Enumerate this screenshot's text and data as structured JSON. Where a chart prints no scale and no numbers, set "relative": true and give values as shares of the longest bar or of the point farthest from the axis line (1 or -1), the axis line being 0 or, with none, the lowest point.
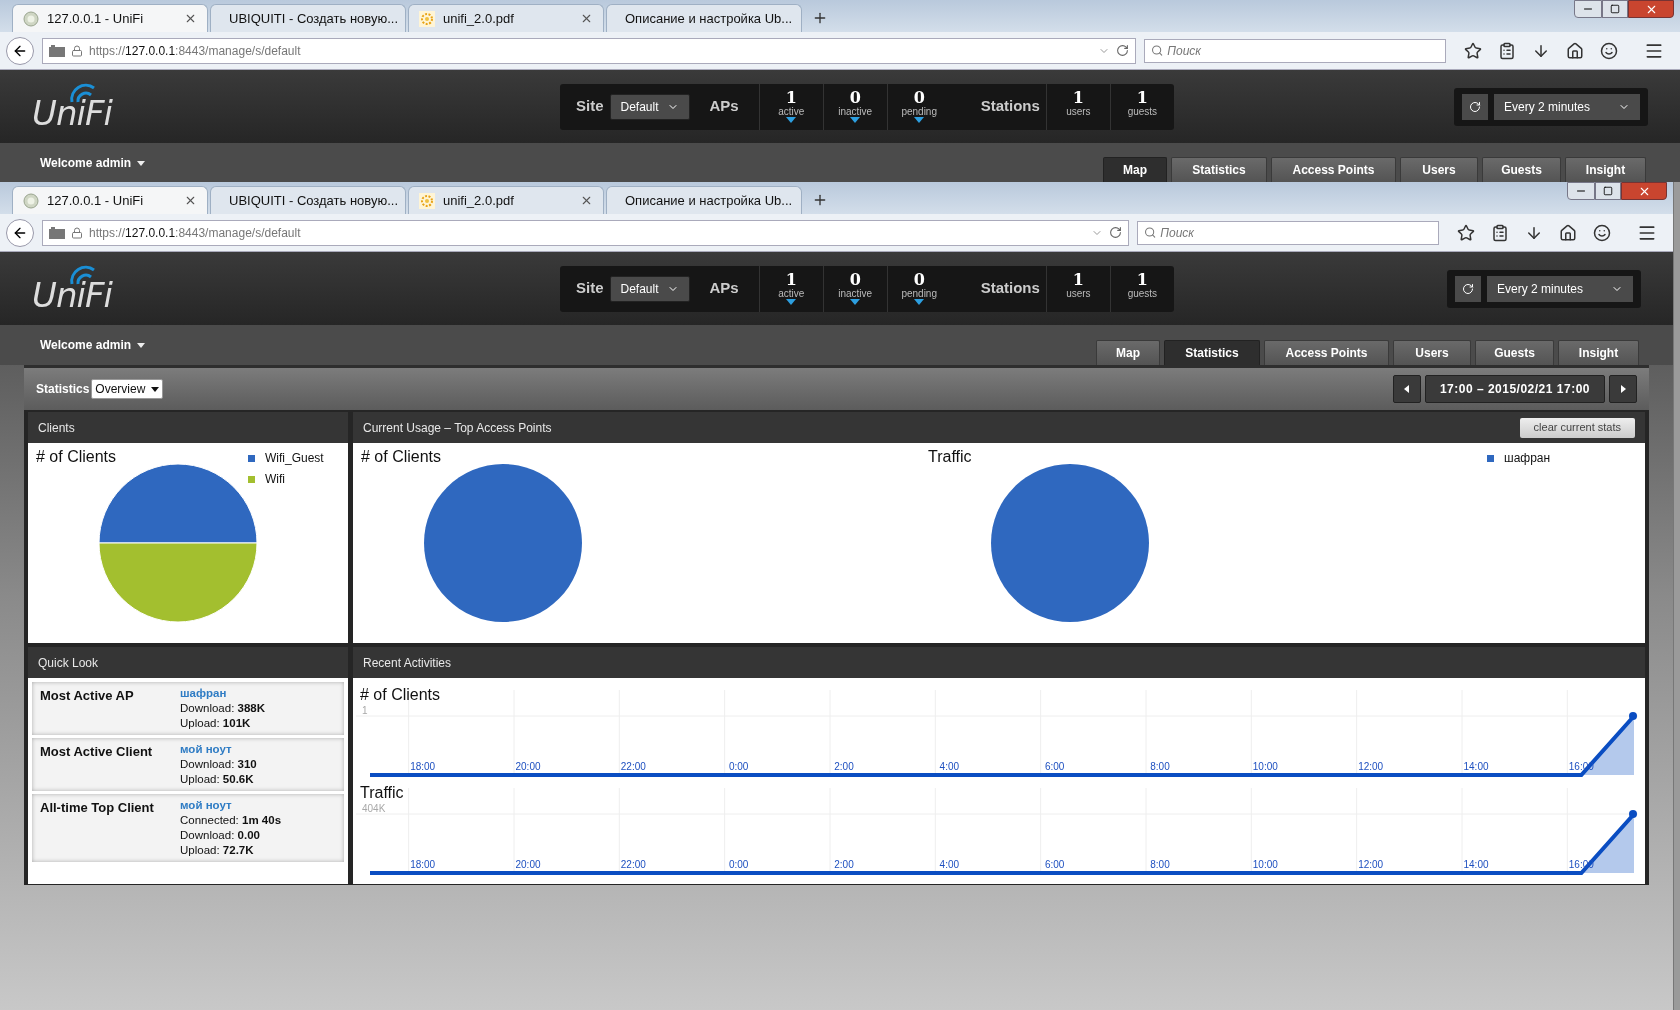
{
  "back_window": {
    "tabs": [
      {
        "kind": "globe",
        "title": "127.0.0.1 - UniFi",
        "selected": true
      },
      {
        "kind": "ubiquiti",
        "title": "UBIQUITI - Создать новую...",
        "selected": false
      },
      {
        "kind": "pdf",
        "title": "unifi_2.0.pdf",
        "selected": false
      },
      {
        "kind": "grid",
        "title": "Описание и настройка Ub...",
        "selected": false
      }
    ],
    "url": {
      "scheme": "https://",
      "host": "127.0.0.1",
      "path": ":8443/manage/s/default"
    },
    "search_placeholder": "Поиск",
    "header": {
      "logo": "UniFi",
      "site_label": "Site",
      "site_value": "Default",
      "aps_label": "APs",
      "aps": [
        {
          "value": "1",
          "label": "active",
          "arrow": true
        },
        {
          "value": "0",
          "label": "inactive",
          "arrow": true
        },
        {
          "value": "0",
          "label": "pending",
          "arrow": true
        }
      ],
      "stations_label": "Stations",
      "stations": [
        {
          "value": "1",
          "label": "users",
          "arrow": false
        },
        {
          "value": "1",
          "label": "guests",
          "arrow": false
        }
      ],
      "refresh": "Every 2 minutes"
    },
    "welcome": "Welcome admin",
    "nav": [
      {
        "label": "Map",
        "selected": true
      },
      {
        "label": "Statistics",
        "selected": false
      },
      {
        "label": "Access Points",
        "selected": false
      },
      {
        "label": "Users",
        "selected": false
      },
      {
        "label": "Guests",
        "selected": false
      },
      {
        "label": "Insight",
        "selected": false
      }
    ]
  },
  "front_window": {
    "tabs": [
      {
        "kind": "globe",
        "title": "127.0.0.1 - UniFi",
        "selected": true
      },
      {
        "kind": "ubiquiti",
        "title": "UBIQUITI - Создать новую...",
        "selected": false
      },
      {
        "kind": "pdf",
        "title": "unifi_2.0.pdf",
        "selected": false
      },
      {
        "kind": "grid",
        "title": "Описание и настройка Ub...",
        "selected": false
      }
    ],
    "url": {
      "scheme": "https://",
      "host": "127.0.0.1",
      "path": ":8443/manage/s/default"
    },
    "search_placeholder": "Поиск",
    "header": {
      "logo": "UniFi",
      "site_label": "Site",
      "site_value": "Default",
      "aps_label": "APs",
      "aps": [
        {
          "value": "1",
          "label": "active",
          "arrow": true
        },
        {
          "value": "0",
          "label": "inactive",
          "arrow": true
        },
        {
          "value": "0",
          "label": "pending",
          "arrow": true
        }
      ],
      "stations_label": "Stations",
      "stations": [
        {
          "value": "1",
          "label": "users",
          "arrow": false
        },
        {
          "value": "1",
          "label": "guests",
          "arrow": false
        }
      ],
      "refresh": "Every 2 minutes"
    },
    "welcome": "Welcome admin",
    "nav": [
      {
        "label": "Map",
        "selected": false
      },
      {
        "label": "Statistics",
        "selected": true
      },
      {
        "label": "Access Points",
        "selected": false
      },
      {
        "label": "Users",
        "selected": false
      },
      {
        "label": "Guests",
        "selected": false
      },
      {
        "label": "Insight",
        "selected": false
      }
    ],
    "statistics": {
      "label": "Statistics",
      "view": "Overview",
      "range": "17:00 – 2015/02/21 17:00",
      "clients": {
        "title": "Clients",
        "chart_title": "# of Clients",
        "legend": [
          {
            "label": "Wifi_Guest",
            "color": "#2f68bf"
          },
          {
            "label": "Wifi",
            "color": "#a3bf2f"
          }
        ]
      },
      "top_aps": {
        "title": "Current Usage – Top Access Points",
        "button": "clear current stats",
        "chart_titles": [
          "# of Clients",
          "Traffic"
        ],
        "legend": [
          {
            "label": "шафран",
            "color": "#2f68bf"
          }
        ]
      },
      "quick_look": {
        "title": "Quick Look",
        "items": [
          {
            "label": "Most Active AP",
            "name": "шафран",
            "stats": [
              {
                "label": "Download:",
                "value": "388K"
              },
              {
                "label": "Upload:",
                "value": "101K"
              }
            ]
          },
          {
            "label": "Most Active Client",
            "name": "мой ноут",
            "stats": [
              {
                "label": "Download:",
                "value": "310"
              },
              {
                "label": "Upload:",
                "value": "50.6K"
              }
            ]
          },
          {
            "label": "All-time Top Client",
            "name": "мой ноут",
            "stats": [
              {
                "label": "Connected:",
                "value": "1m 40s"
              },
              {
                "label": "Download:",
                "value": "0.00"
              },
              {
                "label": "Upload:",
                "value": "72.7K"
              }
            ]
          }
        ]
      },
      "recent": {
        "title": "Recent Activities",
        "charts": [
          {
            "chart_data": {
              "type": "area",
              "title": "# of Clients",
              "relative": true,
              "annotations": [
                "1"
              ],
              "categories": [
                null,
                "18:00",
                null,
                "20:00",
                null,
                "22:00",
                null,
                "0:00",
                null,
                "2:00",
                null,
                "4:00",
                null,
                "6:00",
                null,
                "8:00",
                null,
                "10:00",
                null,
                "12:00",
                null,
                "14:00",
                null,
                "16:00",
                null
              ],
              "series": [
                {
                  "color": "#0a4dc2",
                  "values": [
                    0,
                    0,
                    0,
                    0,
                    0,
                    0,
                    0,
                    0,
                    0,
                    0,
                    0,
                    0,
                    0,
                    0,
                    0,
                    0,
                    0,
                    0,
                    0,
                    0,
                    0,
                    0,
                    0,
                    0,
                    1
                  ]
                }
              ]
            }
          },
          {
            "chart_data": {
              "type": "area",
              "title": "Traffic",
              "relative": true,
              "annotations": [
                "404K"
              ],
              "categories": [
                null,
                "18:00",
                null,
                "20:00",
                null,
                "22:00",
                null,
                "0:00",
                null,
                "2:00",
                null,
                "4:00",
                null,
                "6:00",
                null,
                "8:00",
                null,
                "10:00",
                null,
                "12:00",
                null,
                "14:00",
                null,
                "16:00",
                null
              ],
              "series": [
                {
                  "color": "#0a4dc2",
                  "values": [
                    0,
                    0,
                    0,
                    0,
                    0,
                    0,
                    0,
                    0,
                    0,
                    0,
                    0,
                    0,
                    0,
                    0,
                    0,
                    0,
                    0,
                    0,
                    0,
                    0,
                    0,
                    0,
                    0,
                    0,
                    1
                  ]
                }
              ]
            }
          }
        ]
      }
    }
  }
}
